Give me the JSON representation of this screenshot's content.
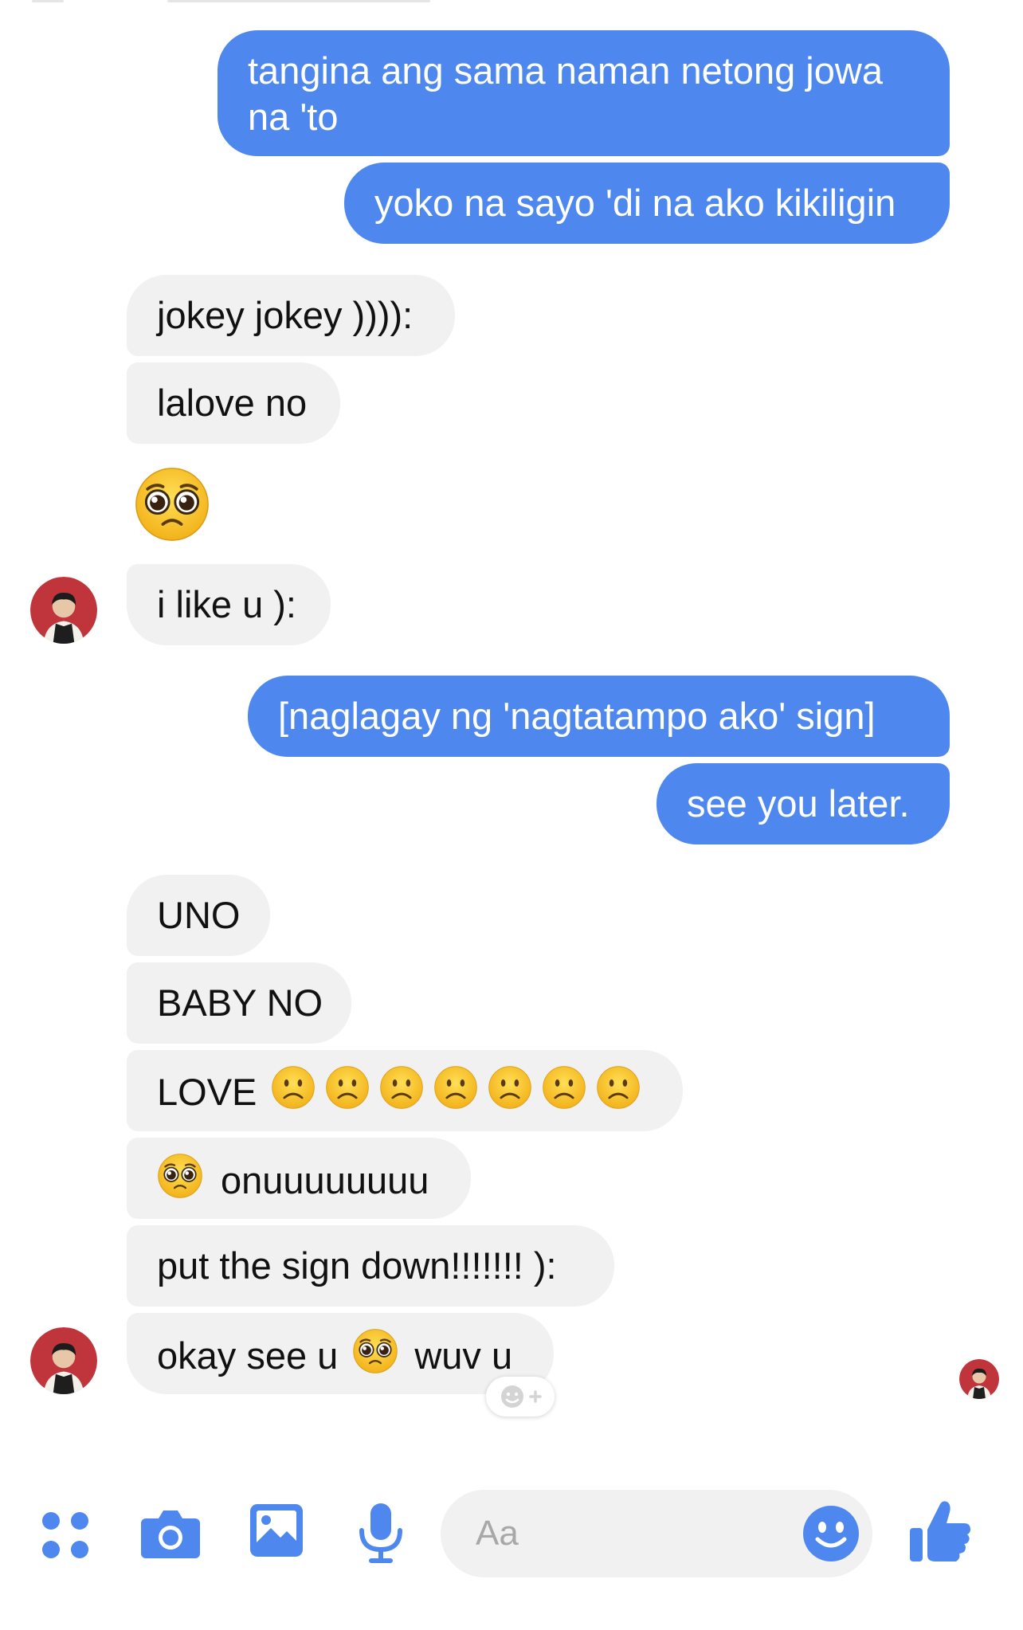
{
  "thread": {
    "messages": [
      {
        "direction": "outgoing",
        "text": "tangina ang sama naman netong jowa na 'to"
      },
      {
        "direction": "outgoing",
        "text": "yoko na sayo 'di na ako kikiligin"
      },
      {
        "direction": "incoming",
        "text": "jokey jokey )))):"
      },
      {
        "direction": "incoming",
        "text": "lalove no"
      },
      {
        "direction": "incoming",
        "emoji": "pleading-face"
      },
      {
        "direction": "incoming",
        "text": "i like u ):"
      },
      {
        "direction": "outgoing",
        "text": "[naglagay ng 'nagtatampo ako' sign]"
      },
      {
        "direction": "outgoing",
        "text": "see you later."
      },
      {
        "direction": "incoming",
        "text": "UNO"
      },
      {
        "direction": "incoming",
        "text": "BABY NO"
      },
      {
        "direction": "incoming",
        "text": "LOVE",
        "trailing_emoji": "slightly-frowning-face",
        "emoji_count": 7
      },
      {
        "direction": "incoming",
        "leading_emoji": "pleading-face",
        "text": "onuuuuuuuu"
      },
      {
        "direction": "incoming",
        "text": "put the sign down!!!!!!! ):"
      },
      {
        "direction": "incoming",
        "text_before": "okay see u",
        "inline_emoji": "pleading-face",
        "text_after": "wuv u"
      }
    ],
    "line1": "tangina ang sama naman netong jowa",
    "line2": "na 'to",
    "reaction_button_icon": "add-reaction-icon",
    "seen_indicator": "avatar"
  },
  "composer": {
    "icons": [
      "apps-icon",
      "camera-icon",
      "photo-icon",
      "microphone-icon",
      "emoji-icon",
      "thumbs-up-icon"
    ],
    "placeholder": "Aa"
  },
  "colors": {
    "outgoing_bubble": "#4e88ef",
    "incoming_bubble": "#f1f1f1",
    "accent": "#4e88ef",
    "emoji_yellow": "#f7c232"
  }
}
